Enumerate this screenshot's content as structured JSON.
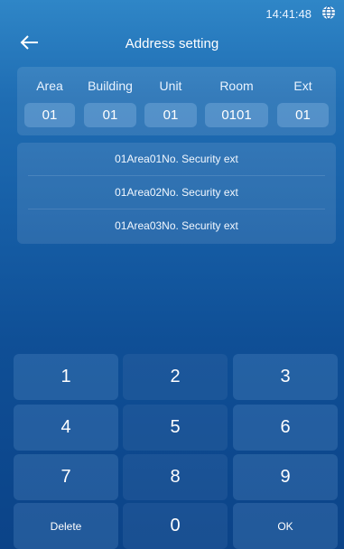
{
  "status": {
    "time": "14:41:48",
    "icon": "globe-icon"
  },
  "header": {
    "title": "Address setting",
    "back_icon": "back-arrow-icon"
  },
  "address": {
    "fields": [
      {
        "label": "Area",
        "value": "01"
      },
      {
        "label": "Building",
        "value": "01"
      },
      {
        "label": "Unit",
        "value": "01"
      },
      {
        "label": "Room",
        "value": "0101"
      },
      {
        "label": "Ext",
        "value": "01"
      }
    ]
  },
  "list": {
    "items": [
      "01Area01No. Security ext",
      "01Area02No. Security ext",
      "01Area03No. Security ext"
    ]
  },
  "keypad": {
    "keys": [
      "1",
      "2",
      "3",
      "4",
      "5",
      "6",
      "7",
      "8",
      "9",
      "Delete",
      "0",
      "OK"
    ]
  },
  "colors": {
    "background_top": "#2f86c7",
    "background_bottom": "#0b4388",
    "text": "#ffffff"
  }
}
